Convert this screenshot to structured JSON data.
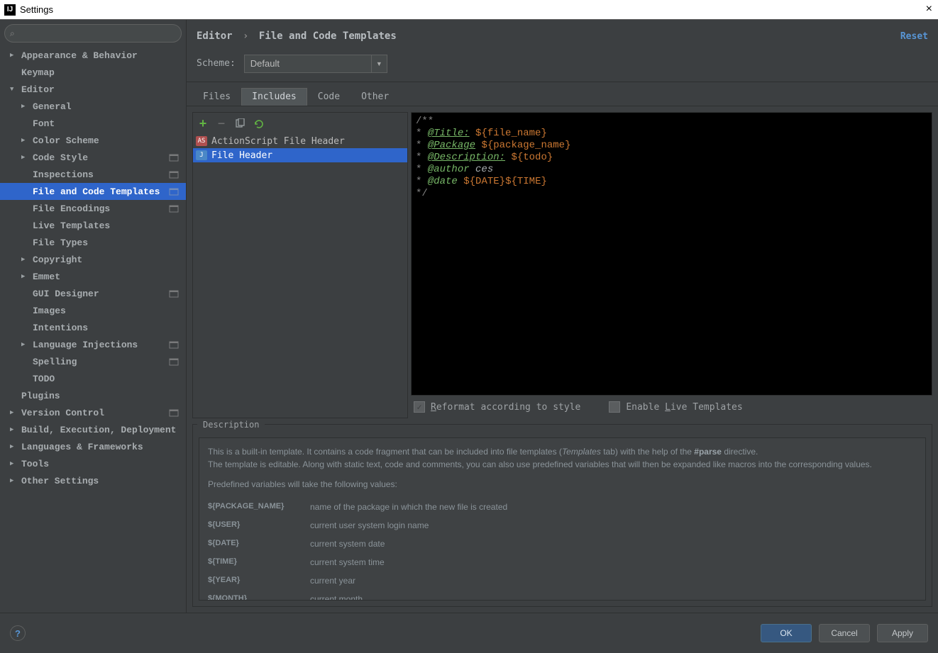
{
  "window": {
    "title": "Settings",
    "close": "×"
  },
  "search": {
    "placeholder": ""
  },
  "sidebar": [
    {
      "label": "Appearance & Behavior",
      "lvl": 0,
      "arrow": "▶"
    },
    {
      "label": "Keymap",
      "lvl": 0,
      "arrow": ""
    },
    {
      "label": "Editor",
      "lvl": 0,
      "arrow": "▼"
    },
    {
      "label": "General",
      "lvl": 1,
      "arrow": "▶"
    },
    {
      "label": "Font",
      "lvl": 1,
      "arrow": ""
    },
    {
      "label": "Color Scheme",
      "lvl": 1,
      "arrow": "▶"
    },
    {
      "label": "Code Style",
      "lvl": 1,
      "arrow": "▶",
      "badge": true
    },
    {
      "label": "Inspections",
      "lvl": 1,
      "arrow": "",
      "badge": true
    },
    {
      "label": "File and Code Templates",
      "lvl": 1,
      "arrow": "",
      "badge": true,
      "selected": true
    },
    {
      "label": "File Encodings",
      "lvl": 1,
      "arrow": "",
      "badge": true
    },
    {
      "label": "Live Templates",
      "lvl": 1,
      "arrow": ""
    },
    {
      "label": "File Types",
      "lvl": 1,
      "arrow": ""
    },
    {
      "label": "Copyright",
      "lvl": 1,
      "arrow": "▶"
    },
    {
      "label": "Emmet",
      "lvl": 1,
      "arrow": "▶"
    },
    {
      "label": "GUI Designer",
      "lvl": 1,
      "arrow": "",
      "badge": true
    },
    {
      "label": "Images",
      "lvl": 1,
      "arrow": ""
    },
    {
      "label": "Intentions",
      "lvl": 1,
      "arrow": ""
    },
    {
      "label": "Language Injections",
      "lvl": 1,
      "arrow": "▶",
      "badge": true
    },
    {
      "label": "Spelling",
      "lvl": 1,
      "arrow": "",
      "badge": true
    },
    {
      "label": "TODO",
      "lvl": 1,
      "arrow": ""
    },
    {
      "label": "Plugins",
      "lvl": 0,
      "arrow": ""
    },
    {
      "label": "Version Control",
      "lvl": 0,
      "arrow": "▶",
      "badge": true
    },
    {
      "label": "Build, Execution, Deployment",
      "lvl": 0,
      "arrow": "▶"
    },
    {
      "label": "Languages & Frameworks",
      "lvl": 0,
      "arrow": "▶"
    },
    {
      "label": "Tools",
      "lvl": 0,
      "arrow": "▶"
    },
    {
      "label": "Other Settings",
      "lvl": 0,
      "arrow": "▶"
    }
  ],
  "breadcrumb": {
    "a": "Editor",
    "sep": "›",
    "b": "File and Code Templates"
  },
  "reset": "Reset",
  "scheme": {
    "label": "Scheme:",
    "value": "Default"
  },
  "tabs": [
    "Files",
    "Includes",
    "Code",
    "Other"
  ],
  "tab_active": 1,
  "file_list": [
    {
      "label": "ActionScript File Header",
      "icon": "as"
    },
    {
      "label": "File Header",
      "icon": "j",
      "selected": true
    }
  ],
  "editor_lines": [
    [
      {
        "t": "/**",
        "c": "cm"
      }
    ],
    [
      {
        "t": " * ",
        "c": "cm"
      },
      {
        "t": "@Title:",
        "c": "tag"
      },
      {
        "t": " ",
        "c": "cm"
      },
      {
        "t": "${",
        "c": "varbr"
      },
      {
        "t": "file_name",
        "c": "var"
      },
      {
        "t": "}",
        "c": "varbr"
      }
    ],
    [
      {
        "t": " * ",
        "c": "cm"
      },
      {
        "t": "@Package",
        "c": "tag"
      },
      {
        "t": " ",
        "c": "cm"
      },
      {
        "t": "${",
        "c": "varbr"
      },
      {
        "t": "package_name",
        "c": "var"
      },
      {
        "t": "}",
        "c": "varbr"
      }
    ],
    [
      {
        "t": " * ",
        "c": "cm"
      },
      {
        "t": "@Description:",
        "c": "tag"
      },
      {
        "t": " ",
        "c": "cm"
      },
      {
        "t": "${",
        "c": "varbr"
      },
      {
        "t": "todo",
        "c": "var"
      },
      {
        "t": "}",
        "c": "varbr"
      }
    ],
    [
      {
        "t": " * ",
        "c": "cm"
      },
      {
        "t": "@author",
        "c": "tag2"
      },
      {
        "t": " ",
        "c": "cm"
      },
      {
        "t": "ces",
        "c": "val"
      }
    ],
    [
      {
        "t": " * ",
        "c": "cm"
      },
      {
        "t": "@date",
        "c": "tag2"
      },
      {
        "t": " ",
        "c": "cm"
      },
      {
        "t": "${",
        "c": "varbr"
      },
      {
        "t": "DATE",
        "c": "var"
      },
      {
        "t": "}",
        "c": "varbr"
      },
      {
        "t": "${",
        "c": "varbr"
      },
      {
        "t": "TIME",
        "c": "var"
      },
      {
        "t": "}",
        "c": "varbr"
      }
    ],
    [
      {
        "t": " */",
        "c": "cm"
      }
    ]
  ],
  "checks": {
    "reformat_pre": "R",
    "reformat": "eformat according to style",
    "live_pre": "Enable ",
    "live_u": "L",
    "live_post": "ive Templates"
  },
  "desc": {
    "title": "Description",
    "p1a": "This is a built-in template. It contains a code fragment that can be included into file templates (",
    "p1i": "Templates",
    "p1b": " tab) with the help of the ",
    "p1c": "#parse",
    "p1d": " directive.",
    "p2": "The template is editable. Along with static text, code and comments, you can also use predefined variables that will then be expanded like macros into the corresponding values.",
    "p3": "Predefined variables will take the following values:",
    "vars": [
      {
        "k": "${PACKAGE_NAME}",
        "v": "name of the package in which the new file is created"
      },
      {
        "k": "${USER}",
        "v": "current user system login name"
      },
      {
        "k": "${DATE}",
        "v": "current system date"
      },
      {
        "k": "${TIME}",
        "v": "current system time"
      },
      {
        "k": "${YEAR}",
        "v": "current year"
      },
      {
        "k": "${MONTH}",
        "v": "current month"
      }
    ]
  },
  "footer": {
    "ok": "OK",
    "cancel": "Cancel",
    "apply": "Apply"
  }
}
